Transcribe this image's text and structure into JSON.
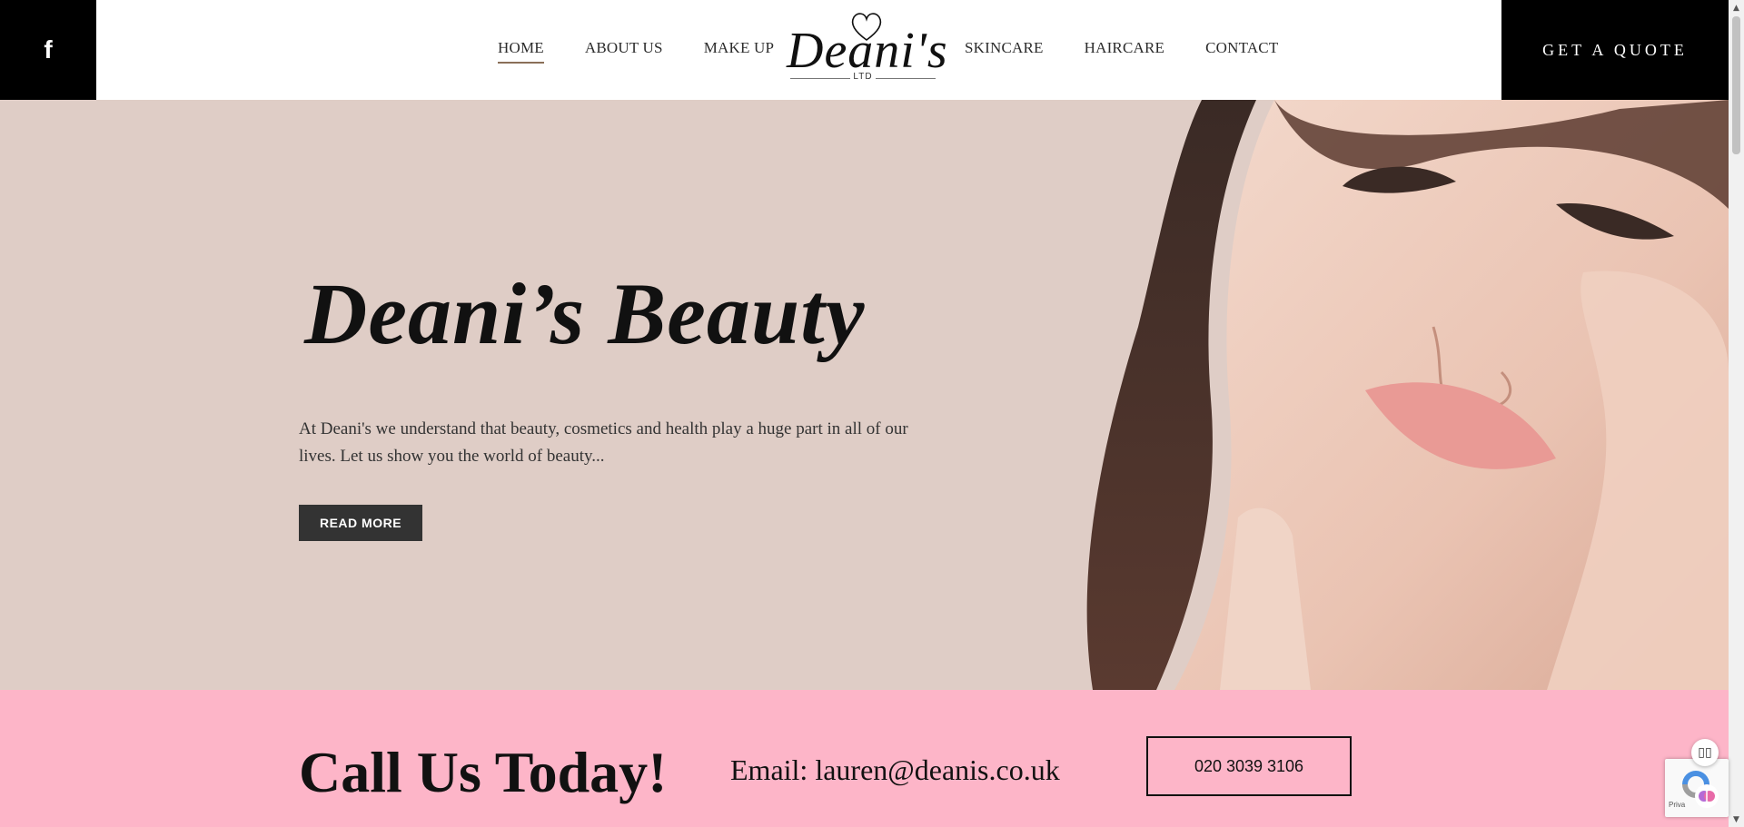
{
  "header": {
    "social_icon": "facebook-icon",
    "social_glyph": "f",
    "nav_left": [
      {
        "label": "HOME"
      },
      {
        "label": "ABOUT US"
      },
      {
        "label": "MAKE UP"
      }
    ],
    "nav_right": [
      {
        "label": "SKINCARE"
      },
      {
        "label": "HAIRCARE"
      },
      {
        "label": "CONTACT"
      }
    ],
    "logo": {
      "name": "Deani's",
      "suffix": "LTD"
    },
    "quote_button": "GET A QUOTE"
  },
  "hero": {
    "title": "Deani’s Beauty",
    "text": "At Deani's we understand that beauty, cosmetics and health play a huge part in all of our lives. Let us show you the world of beauty...",
    "button": "READ MORE",
    "background_color": "#dfcdc6"
  },
  "call_band": {
    "title": "Call Us Today!",
    "email": "Email: lauren@deanis.co.uk",
    "phone": "020 3039 3106",
    "background_color": "#fdb5c8"
  },
  "widgets": {
    "recaptcha_text": "Priva",
    "reader_icon": "book-icon"
  }
}
